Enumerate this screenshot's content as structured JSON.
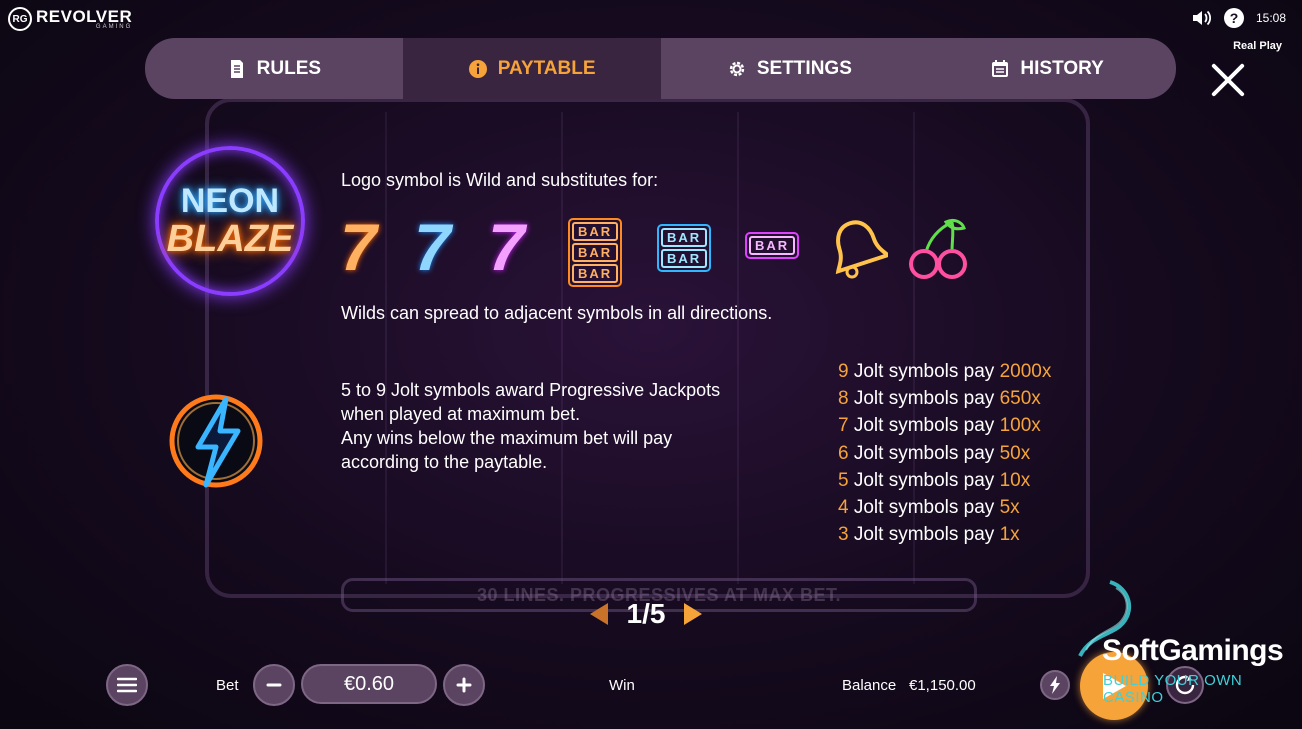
{
  "brand": {
    "badge": "RG",
    "name": "REVOLVER",
    "sub": "GAMING"
  },
  "status": {
    "time": "15:08",
    "mode": "Real Play",
    "help": "?"
  },
  "tabs": [
    {
      "label": "RULES",
      "icon": "document-icon"
    },
    {
      "label": "PAYTABLE",
      "icon": "info-icon",
      "active": true
    },
    {
      "label": "SETTINGS",
      "icon": "gear-icon"
    },
    {
      "label": "HISTORY",
      "icon": "calendar-icon"
    }
  ],
  "logo": {
    "line1": "NEON",
    "line2": "BLAZE"
  },
  "wild": {
    "text": "Logo symbol is Wild and substitutes for:",
    "spread": "Wilds can spread to adjacent symbols in all directions.",
    "bar": "BAR"
  },
  "jolt": {
    "line1": "5 to 9 Jolt symbols award Progressive Jackpots",
    "line2": "when played at maximum bet.",
    "line3": "Any wins below the maximum bet will pay",
    "line4": "according to the paytable.",
    "pays": [
      {
        "count": "9",
        "text": " Jolt symbols pay ",
        "mult": "2000x"
      },
      {
        "count": "8",
        "text": " Jolt symbols pay ",
        "mult": "650x"
      },
      {
        "count": "7",
        "text": " Jolt symbols pay ",
        "mult": "100x"
      },
      {
        "count": "6",
        "text": " Jolt symbols pay ",
        "mult": "50x"
      },
      {
        "count": "5",
        "text": " Jolt symbols pay ",
        "mult": "10x"
      },
      {
        "count": "4",
        "text": " Jolt symbols pay ",
        "mult": "5x"
      },
      {
        "count": "3",
        "text": " Jolt symbols pay ",
        "mult": "1x"
      }
    ]
  },
  "info_bar": "30 LINES. PROGRESSIVES AT MAX BET.",
  "pager": {
    "current": "1/5"
  },
  "footer": {
    "bet_label": "Bet",
    "bet_value": "€0.60",
    "win_label": "Win",
    "balance_label": "Balance",
    "balance_value": "€1,150.00"
  },
  "watermark": {
    "name": "SoftGamings",
    "tag": "BUILD YOUR OWN CASINO"
  },
  "colors": {
    "accent": "#f6a33a",
    "panel": "#5b4461",
    "active_tab": "#3a2540"
  }
}
